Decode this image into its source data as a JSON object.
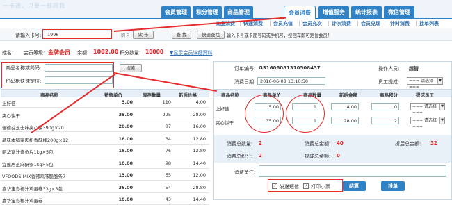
{
  "header": {
    "slogan": "一卡通，只要一部同我",
    "nav": [
      "会员管理",
      "积分管理",
      "商品管理",
      "会员消费",
      "增值服务",
      "统计报表",
      "微信管理"
    ],
    "active": "会员消费",
    "subnav": [
      "商品消费",
      "快速消费",
      "会员充值",
      "会员充次",
      "计次消费",
      "会员兑现",
      "计时消费",
      "挂单列表"
    ]
  },
  "card": {
    "label": "请输入卡号:",
    "value": "1996",
    "reader_prefix": "刷卡",
    "read_btn": "读 卡",
    "find_btn": "查 找",
    "quick_btn": "快速查找",
    "hint": "输入卡号或卡面号码或手机号，按回车即可定位会员！"
  },
  "member": {
    "name_label": "姓名:",
    "level_label": "会员等级:",
    "level": "金牌会员",
    "balance_label": "余额:",
    "balance": "1002.00",
    "points_label": "积分数量:",
    "points": "10000",
    "detail_link": "▼显示会员详细资料"
  },
  "search": {
    "name_label": "商品名称或简码:",
    "search_btn": "搜索",
    "scan_label": "扫码枪快速定位:"
  },
  "product_table": {
    "headers": [
      "商品名称",
      "销售单价",
      "库存数量",
      "新后价格"
    ],
    "rows": [
      [
        "上好佳",
        "5.00",
        "110",
        "4.00"
      ],
      [
        "夹心饼干",
        "35.00",
        "225",
        "28.00"
      ],
      [
        "御德芬芝士味夹心饼390g×20",
        "20.00",
        "87",
        "16.00"
      ],
      [
        "晶味本铺家肉松香酥棒200g×12",
        "16.00",
        "34",
        "12.80"
      ],
      [
        "丽华富汁烧鱼片1kg×5包",
        "16.00",
        "76",
        "12.80"
      ],
      [
        "宜莲居芝麻酥条1kg×5包",
        "18.00",
        "98",
        "14.40"
      ],
      [
        "VFOODS MIX香辣鸡味脆脆条7",
        "15.00",
        "65",
        "12.00"
      ],
      [
        "嘉华宝岛椰汁鸡蛋卷33g×5包",
        "36.00",
        "54",
        "28.80"
      ],
      [
        "嘉华宝岛椰汁鸡蛋卷",
        "18.00",
        "43",
        "14.40"
      ]
    ]
  },
  "order": {
    "no_label": "订单编号:",
    "no": "GS1606081310508437",
    "operator_label": "操作人员:",
    "operator": "超管",
    "date_label": "消费日期:",
    "date": "2016-06-08 13:10:50",
    "staff_label": "员工提成:",
    "staff_select": "=== 请选择 ==="
  },
  "cart": {
    "headers": [
      "商品名称",
      "商品单价",
      "商品数量",
      "新后金额",
      "商品积分",
      "提成员工"
    ],
    "rows": [
      {
        "name": "上好佳",
        "price": "5.00",
        "qty": "1",
        "amount": "4.00",
        "points": "0",
        "staff": "=== 请选择 ==="
      },
      {
        "name": "夹心饼干",
        "price": "35.00",
        "qty": "1",
        "amount": "28.00",
        "points": "2",
        "staff": "=== 请选择 ==="
      }
    ]
  },
  "summary": {
    "qty_label": "消费总数量:",
    "qty": "2",
    "amount_label": "消费总金额:",
    "amount": "40",
    "disc_label": "折后总金额:",
    "disc": "32",
    "points_label": "消费总积分:",
    "points": "2",
    "recv_label": "提成总金额:",
    "recv": "0",
    "remark_label": "消费备注:"
  },
  "actions": {
    "sms": "发送短信",
    "print": "打印小票",
    "settle": "结算",
    "hold": "挂单"
  },
  "colors": {
    "accent": "#2f7fc4",
    "highlight": "#e52b2b"
  }
}
